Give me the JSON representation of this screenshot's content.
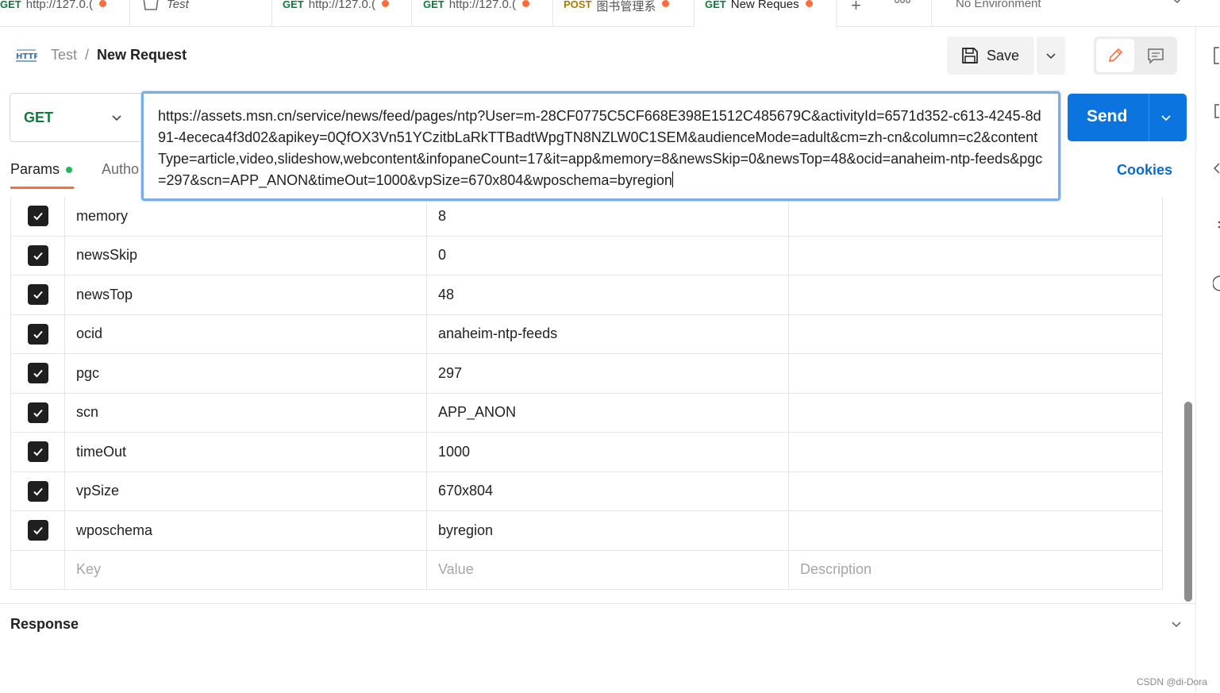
{
  "tabs": [
    {
      "method": "GET",
      "title": "http://127.0.(",
      "unsaved": true
    },
    {
      "method": "",
      "title": "Test",
      "unsaved": false
    },
    {
      "method": "GET",
      "title": "http://127.0.(",
      "unsaved": true
    },
    {
      "method": "GET",
      "title": "http://127.0.(",
      "unsaved": true
    },
    {
      "method": "POST",
      "title": "图书管理系",
      "unsaved": true
    },
    {
      "method": "GET",
      "title": "New Reques",
      "unsaved": true
    }
  ],
  "environment": "No Environment",
  "breadcrumb": {
    "parent": "Test",
    "separator": "/",
    "current": "New Request"
  },
  "toolbar": {
    "save_label": "Save"
  },
  "request": {
    "method": "GET",
    "url": "https://assets.msn.cn/service/news/feed/pages/ntp?User=m-28CF0775C5CF668E398E1512C485679C&activityId=6571d352-c613-4245-8d91-4ececa4f3d02&apikey=0QfOX3Vn51YCzitbLaRkTTBadtWpgTN8NZLW0C1SEM&audienceMode=adult&cm=zh-cn&column=c2&contentType=article,video,slideshow,webcontent&infopaneCount=17&it=app&memory=8&newsSkip=0&newsTop=48&ocid=anaheim-ntp-feeds&pgc=297&scn=APP_ANON&timeOut=1000&vpSize=670x804&wposchema=byregion",
    "send_label": "Send"
  },
  "subtabs": {
    "params": "Params",
    "auth": "Autho",
    "cookies": "Cookies"
  },
  "params": [
    {
      "key": "memory",
      "value": "8",
      "checked": true
    },
    {
      "key": "newsSkip",
      "value": "0",
      "checked": true
    },
    {
      "key": "newsTop",
      "value": "48",
      "checked": true
    },
    {
      "key": "ocid",
      "value": "anaheim-ntp-feeds",
      "checked": true
    },
    {
      "key": "pgc",
      "value": "297",
      "checked": true
    },
    {
      "key": "scn",
      "value": "APP_ANON",
      "checked": true
    },
    {
      "key": "timeOut",
      "value": "1000",
      "checked": true
    },
    {
      "key": "vpSize",
      "value": "670x804",
      "checked": true
    },
    {
      "key": "wposchema",
      "value": "byregion",
      "checked": true
    }
  ],
  "placeholders": {
    "key": "Key",
    "value": "Value",
    "description": "Description"
  },
  "response": {
    "title": "Response"
  },
  "watermark": "CSDN @di-Dora",
  "colors": {
    "accent": "#ff6c37",
    "send": "#0b74de",
    "get": "#0f7b3a",
    "post": "#ad7a03"
  }
}
